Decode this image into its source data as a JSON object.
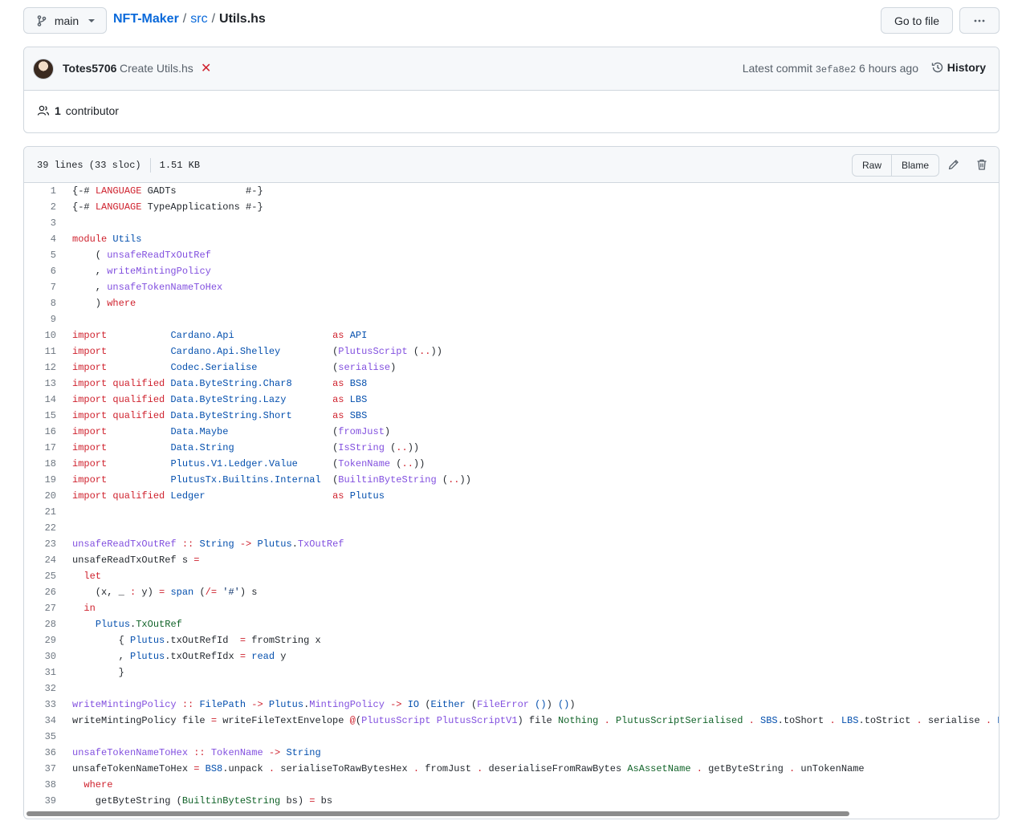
{
  "header": {
    "branch": "main",
    "repo": "NFT-Maker",
    "dir": "src",
    "file": "Utils.hs",
    "goto_label": "Go to file",
    "more_label": "···"
  },
  "commit": {
    "author": "Totes5706",
    "message": "Create Utils.hs",
    "latest_label": "Latest commit",
    "sha": "3efa8e2",
    "age": "6 hours ago",
    "history_label": "History",
    "contributors_count": "1",
    "contributors_label": "contributor"
  },
  "file": {
    "lines_info": "39 lines (33 sloc)",
    "size": "1.51 KB",
    "raw_label": "Raw",
    "blame_label": "Blame"
  },
  "code": [
    [
      [
        "",
        "{-# "
      ],
      [
        "k",
        "LANGUAGE"
      ],
      [
        "",
        " GADTs            #-}"
      ]
    ],
    [
      [
        "",
        "{-# "
      ],
      [
        "k",
        "LANGUAGE"
      ],
      [
        "",
        " TypeApplications #-}"
      ]
    ],
    [],
    [
      [
        "k",
        "module"
      ],
      [
        "",
        " "
      ],
      [
        "m",
        "Utils"
      ]
    ],
    [
      [
        "",
        "    ( "
      ],
      [
        "f",
        "unsafeReadTxOutRef"
      ]
    ],
    [
      [
        "",
        "    , "
      ],
      [
        "f",
        "writeMintingPolicy"
      ]
    ],
    [
      [
        "",
        "    , "
      ],
      [
        "f",
        "unsafeTokenNameToHex"
      ]
    ],
    [
      [
        "",
        "    ) "
      ],
      [
        "k",
        "where"
      ]
    ],
    [],
    [
      [
        "k",
        "import"
      ],
      [
        "",
        "           "
      ],
      [
        "m",
        "Cardano.Api"
      ],
      [
        "",
        "                 "
      ],
      [
        "k",
        "as"
      ],
      [
        "",
        " "
      ],
      [
        "m",
        "API"
      ]
    ],
    [
      [
        "k",
        "import"
      ],
      [
        "",
        "           "
      ],
      [
        "m",
        "Cardano.Api.Shelley"
      ],
      [
        "",
        "         ("
      ],
      [
        "f",
        "PlutusScript"
      ],
      [
        "",
        " ("
      ],
      [
        "k",
        ".."
      ],
      [
        "",
        "))"
      ]
    ],
    [
      [
        "k",
        "import"
      ],
      [
        "",
        "           "
      ],
      [
        "m",
        "Codec.Serialise"
      ],
      [
        "",
        "             ("
      ],
      [
        "f",
        "serialise"
      ],
      [
        "",
        ")"
      ]
    ],
    [
      [
        "k",
        "import qualified"
      ],
      [
        "",
        " "
      ],
      [
        "m",
        "Data.ByteString.Char8"
      ],
      [
        "",
        "       "
      ],
      [
        "k",
        "as"
      ],
      [
        "",
        " "
      ],
      [
        "m",
        "BS8"
      ]
    ],
    [
      [
        "k",
        "import qualified"
      ],
      [
        "",
        " "
      ],
      [
        "m",
        "Data.ByteString.Lazy"
      ],
      [
        "",
        "        "
      ],
      [
        "k",
        "as"
      ],
      [
        "",
        " "
      ],
      [
        "m",
        "LBS"
      ]
    ],
    [
      [
        "k",
        "import qualified"
      ],
      [
        "",
        " "
      ],
      [
        "m",
        "Data.ByteString.Short"
      ],
      [
        "",
        "       "
      ],
      [
        "k",
        "as"
      ],
      [
        "",
        " "
      ],
      [
        "m",
        "SBS"
      ]
    ],
    [
      [
        "k",
        "import"
      ],
      [
        "",
        "           "
      ],
      [
        "m",
        "Data.Maybe"
      ],
      [
        "",
        "                  ("
      ],
      [
        "f",
        "fromJust"
      ],
      [
        "",
        ")"
      ]
    ],
    [
      [
        "k",
        "import"
      ],
      [
        "",
        "           "
      ],
      [
        "m",
        "Data.String"
      ],
      [
        "",
        "                 ("
      ],
      [
        "f",
        "IsString"
      ],
      [
        "",
        " ("
      ],
      [
        "k",
        ".."
      ],
      [
        "",
        "))"
      ]
    ],
    [
      [
        "k",
        "import"
      ],
      [
        "",
        "           "
      ],
      [
        "m",
        "Plutus.V1.Ledger.Value"
      ],
      [
        "",
        "      ("
      ],
      [
        "f",
        "TokenName"
      ],
      [
        "",
        " ("
      ],
      [
        "k",
        ".."
      ],
      [
        "",
        "))"
      ]
    ],
    [
      [
        "k",
        "import"
      ],
      [
        "",
        "           "
      ],
      [
        "m",
        "PlutusTx.Builtins.Internal"
      ],
      [
        "",
        "  ("
      ],
      [
        "f",
        "BuiltinByteString"
      ],
      [
        "",
        " ("
      ],
      [
        "k",
        ".."
      ],
      [
        "",
        "))"
      ]
    ],
    [
      [
        "k",
        "import qualified"
      ],
      [
        "",
        " "
      ],
      [
        "m",
        "Ledger"
      ],
      [
        "",
        "                      "
      ],
      [
        "k",
        "as"
      ],
      [
        "",
        " "
      ],
      [
        "m",
        "Plutus"
      ]
    ],
    [],
    [],
    [
      [
        "f",
        "unsafeReadTxOutRef"
      ],
      [
        "",
        " "
      ],
      [
        "k",
        "::"
      ],
      [
        "",
        " "
      ],
      [
        "m",
        "String"
      ],
      [
        "",
        " "
      ],
      [
        "k",
        "->"
      ],
      [
        "",
        " "
      ],
      [
        "m",
        "Plutus"
      ],
      [
        "",
        "."
      ],
      [
        "f",
        "TxOutRef"
      ]
    ],
    [
      [
        "",
        "unsafeReadTxOutRef s "
      ],
      [
        "k",
        "="
      ]
    ],
    [
      [
        "",
        "  "
      ],
      [
        "k",
        "let"
      ]
    ],
    [
      [
        "",
        "    (x, _ "
      ],
      [
        "k",
        ":"
      ],
      [
        "",
        " y) "
      ],
      [
        "k",
        "="
      ],
      [
        "",
        " "
      ],
      [
        "m",
        "span"
      ],
      [
        "",
        " ("
      ],
      [
        "k",
        "/="
      ],
      [
        "",
        " "
      ],
      [
        "s",
        "'#'"
      ],
      [
        "",
        ") s"
      ]
    ],
    [
      [
        "",
        "  "
      ],
      [
        "k",
        "in"
      ]
    ],
    [
      [
        "",
        "    "
      ],
      [
        "m",
        "Plutus"
      ],
      [
        "",
        "."
      ],
      [
        "g",
        "TxOutRef"
      ]
    ],
    [
      [
        "",
        "        { "
      ],
      [
        "m",
        "Plutus"
      ],
      [
        "",
        ".txOutRefId  "
      ],
      [
        "k",
        "="
      ],
      [
        "",
        " fromString x"
      ]
    ],
    [
      [
        "",
        "        , "
      ],
      [
        "m",
        "Plutus"
      ],
      [
        "",
        ".txOutRefIdx "
      ],
      [
        "k",
        "="
      ],
      [
        "",
        " "
      ],
      [
        "m",
        "read"
      ],
      [
        "",
        " y"
      ]
    ],
    [
      [
        "",
        "        }"
      ]
    ],
    [],
    [
      [
        "f",
        "writeMintingPolicy"
      ],
      [
        "",
        " "
      ],
      [
        "k",
        "::"
      ],
      [
        "",
        " "
      ],
      [
        "m",
        "FilePath"
      ],
      [
        "",
        " "
      ],
      [
        "k",
        "->"
      ],
      [
        "",
        " "
      ],
      [
        "m",
        "Plutus"
      ],
      [
        "",
        "."
      ],
      [
        "f",
        "MintingPolicy"
      ],
      [
        "",
        " "
      ],
      [
        "k",
        "->"
      ],
      [
        "",
        " "
      ],
      [
        "m",
        "IO"
      ],
      [
        "",
        " ("
      ],
      [
        "m",
        "Either"
      ],
      [
        "",
        " ("
      ],
      [
        "f",
        "FileError"
      ],
      [
        "",
        " "
      ],
      [
        "m",
        "()"
      ],
      [
        "",
        ") "
      ],
      [
        "m",
        "()"
      ],
      [
        "",
        ")"
      ]
    ],
    [
      [
        "",
        "writeMintingPolicy file "
      ],
      [
        "k",
        "="
      ],
      [
        "",
        " writeFileTextEnvelope "
      ],
      [
        "k",
        "@"
      ],
      [
        "",
        "("
      ],
      [
        "f",
        "PlutusScript"
      ],
      [
        "",
        " "
      ],
      [
        "f",
        "PlutusScriptV1"
      ],
      [
        "",
        ") file "
      ],
      [
        "g",
        "Nothing"
      ],
      [
        "",
        " "
      ],
      [
        "k",
        "."
      ],
      [
        "",
        " "
      ],
      [
        "g",
        "PlutusScriptSerialised"
      ],
      [
        "",
        " "
      ],
      [
        "k",
        "."
      ],
      [
        "",
        " "
      ],
      [
        "m",
        "SBS"
      ],
      [
        "",
        ".toShort "
      ],
      [
        "k",
        "."
      ],
      [
        "",
        " "
      ],
      [
        "m",
        "LBS"
      ],
      [
        "",
        ".toStrict "
      ],
      [
        "k",
        "."
      ],
      [
        "",
        " serialise "
      ],
      [
        "k",
        "."
      ],
      [
        "",
        " "
      ],
      [
        "m",
        "P"
      ]
    ],
    [],
    [
      [
        "f",
        "unsafeTokenNameToHex"
      ],
      [
        "",
        " "
      ],
      [
        "k",
        "::"
      ],
      [
        "",
        " "
      ],
      [
        "f",
        "TokenName"
      ],
      [
        "",
        " "
      ],
      [
        "k",
        "->"
      ],
      [
        "",
        " "
      ],
      [
        "m",
        "String"
      ]
    ],
    [
      [
        "",
        "unsafeTokenNameToHex "
      ],
      [
        "k",
        "="
      ],
      [
        "",
        " "
      ],
      [
        "m",
        "BS8"
      ],
      [
        "",
        ".unpack "
      ],
      [
        "k",
        "."
      ],
      [
        "",
        " serialiseToRawBytesHex "
      ],
      [
        "k",
        "."
      ],
      [
        "",
        " fromJust "
      ],
      [
        "k",
        "."
      ],
      [
        "",
        " deserialiseFromRawBytes "
      ],
      [
        "g",
        "AsAssetName"
      ],
      [
        "",
        " "
      ],
      [
        "k",
        "."
      ],
      [
        "",
        " getByteString "
      ],
      [
        "k",
        "."
      ],
      [
        "",
        " unTokenName"
      ]
    ],
    [
      [
        "",
        "  "
      ],
      [
        "k",
        "where"
      ]
    ],
    [
      [
        "",
        "    getByteString ("
      ],
      [
        "g",
        "BuiltinByteString"
      ],
      [
        "",
        " bs) "
      ],
      [
        "k",
        "="
      ],
      [
        "",
        " bs"
      ]
    ]
  ]
}
